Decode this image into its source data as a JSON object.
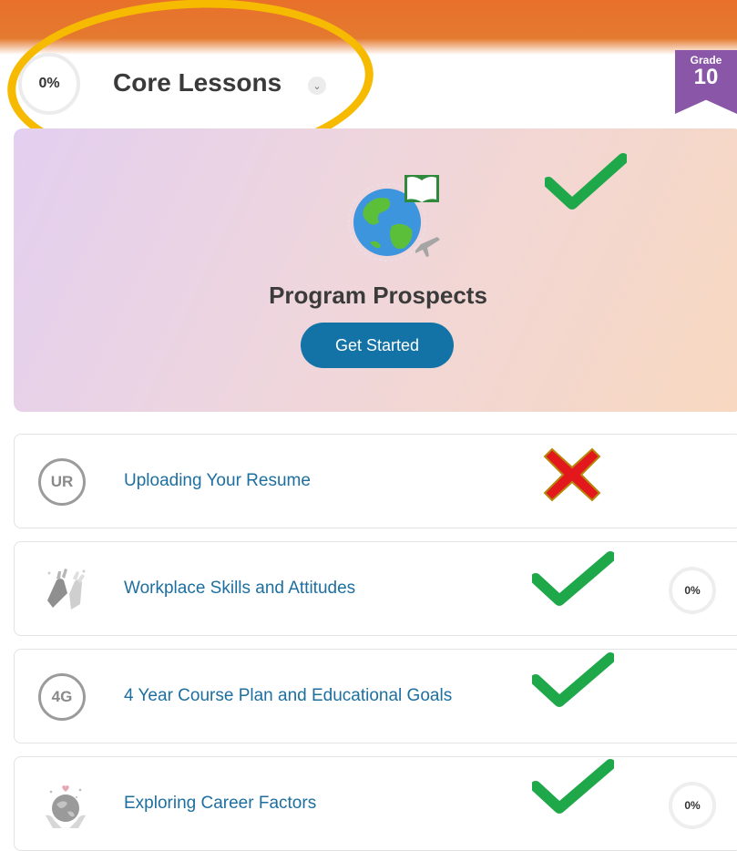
{
  "header": {
    "progress": "0%",
    "section_title": "Core Lessons",
    "chevron": "⌄"
  },
  "grade_badge": {
    "label": "Grade",
    "number": "10"
  },
  "hero": {
    "title": "Program Prospects",
    "button_label": "Get Started",
    "icon": "globe-book-airplane-icon"
  },
  "lessons": [
    {
      "initials": "UR",
      "title": "Uploading Your Resume",
      "annotation": "red-x-icon"
    },
    {
      "icon": "high-five-hands-icon",
      "title": "Workplace Skills and Attitudes",
      "progress": "0%",
      "annotation": "green-check-icon"
    },
    {
      "initials": "4G",
      "title": "4 Year Course Plan and Educational Goals",
      "annotation": "green-check-icon"
    },
    {
      "icon": "hands-globe-heart-icon",
      "title": "Exploring Career Factors",
      "progress": "0%",
      "annotation": "green-check-icon"
    }
  ],
  "colors": {
    "orange_bar": "#e8702a",
    "highlight_oval": "#f6bb00",
    "grade_purple": "#8a57a8",
    "button_blue": "#1473a6",
    "link_blue": "#1d6fa0",
    "check_green": "#1fa84a",
    "x_red": "#e3181d"
  }
}
